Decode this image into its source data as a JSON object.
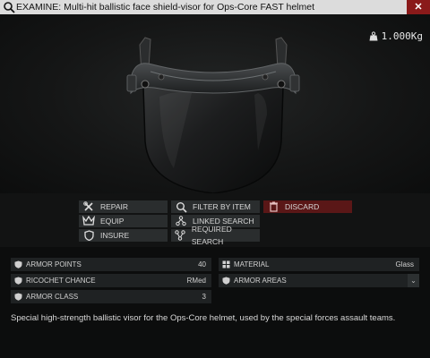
{
  "window": {
    "title": "EXAMINE: Multi-hit ballistic face shield-visor for Ops-Core FAST helmet",
    "close_label": "✕",
    "weight": "1.000Kg"
  },
  "menu": {
    "repair": "REPAIR",
    "equip": "EQUIP",
    "insure": "INSURE",
    "filter_by_item": "FILTER BY ITEM",
    "linked_search": "LINKED SEARCH",
    "required_search": "REQUIRED SEARCH",
    "discard": "DISCARD"
  },
  "stats": {
    "armor_points": {
      "label": "ARMOR POINTS",
      "value": "40"
    },
    "ricochet_chance": {
      "label": "RICOCHET CHANCE",
      "value": "RMed"
    },
    "armor_class": {
      "label": "ARMOR CLASS",
      "value": "3"
    },
    "material": {
      "label": "MATERIAL",
      "value": "Glass"
    },
    "armor_areas": {
      "label": "ARMOR AREAS",
      "dropdown": "⌄"
    }
  },
  "description": "Special high-strength ballistic visor for the Ops-Core helmet, used by the special forces assault teams.",
  "colors": {
    "title_bar": "#dcdcdc",
    "close_button": "#8a1a1a",
    "discard_button": "#5a1717",
    "menu_button": "#2a2d2e",
    "stat_row": "#1f2223"
  },
  "icons": {
    "title": "magnifier-icon",
    "weight": "weight-icon",
    "repair": "wrench-screwdriver-icon",
    "equip": "equip-icon",
    "insure": "shield-icon",
    "filter": "filter-magnifier-icon",
    "linked": "linked-nodes-icon",
    "required": "required-nodes-icon",
    "discard": "trash-icon"
  }
}
